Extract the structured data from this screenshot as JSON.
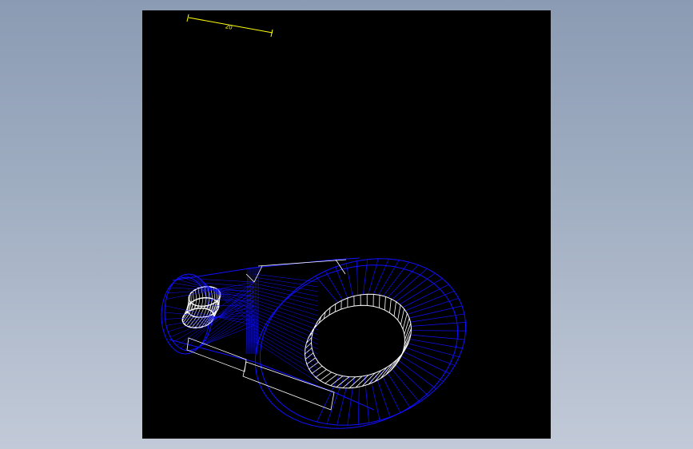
{
  "scale_bar": {
    "label": "20"
  },
  "colors": {
    "background_top": "#8a9bb3",
    "background_bottom": "#c2cad8",
    "viewport": "#000000",
    "wireframe": "#1010ff",
    "edges": "#ffffff",
    "scale_bar": "#ffff00"
  },
  "icons": {
    "model": "wireframe-crank-arm-icon"
  }
}
